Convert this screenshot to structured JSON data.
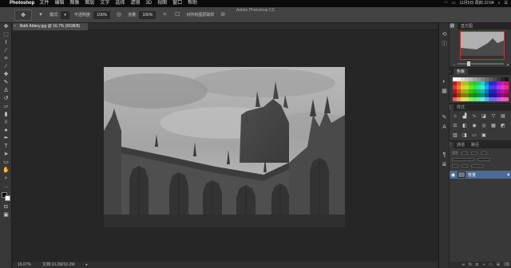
{
  "menubar": {
    "app_name": "Photoshop",
    "items": [
      "文件",
      "编辑",
      "图像",
      "图层",
      "文字",
      "选择",
      "滤镜",
      "3D",
      "视图",
      "窗口",
      "帮助"
    ],
    "clock": "11月5日 周四 22:04",
    "status_icons": [
      "wifi-icon",
      "battery-icon",
      "search-icon",
      "list-icon"
    ]
  },
  "window": {
    "title": "Adobe Photoshop CC"
  },
  "options": {
    "tool_icon": "✥",
    "opacity_label": "不透明度:",
    "opacity_value": "100%",
    "flow_label": "流量:",
    "flow_value": "100%",
    "mode_label": "模式:",
    "sample_all_label": "对所有图层取样"
  },
  "document": {
    "tab_title": "Bath Abbey.jpg @ 16.7% (RGB/8)",
    "zoom": "16.67%",
    "doc_info": "文档:10.2M/10.2M"
  },
  "panels": {
    "navigator_tabs": [
      "导航器",
      "直方图"
    ],
    "color_tabs": [
      "颜色",
      "色板"
    ],
    "adjust_tabs": [
      "调整",
      "样式"
    ],
    "layers_tabs": [
      "图层",
      "通道",
      "路径"
    ],
    "layer_name": "背景",
    "kind_label": "类型"
  },
  "colors": {
    "bg_dark": "#262626",
    "panel": "#383838",
    "selection_blue": "#4d6a92",
    "foreground": "#000000",
    "background": "#ffffff"
  }
}
